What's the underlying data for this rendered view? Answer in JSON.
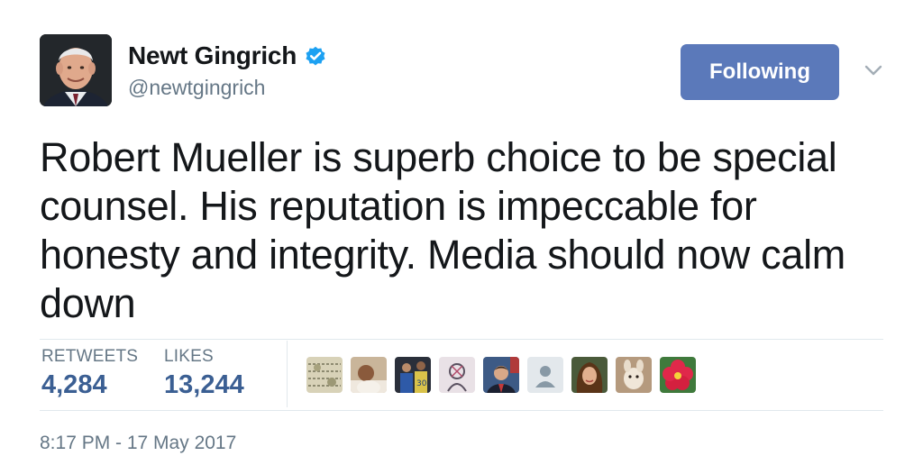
{
  "tweet": {
    "author": {
      "display_name": "Newt Gingrich",
      "handle": "@newtgingrich",
      "verified": true,
      "avatar_icon": "profile-photo"
    },
    "follow_button_label": "Following",
    "menu_icon": "chevron-down-icon",
    "text": "Robert Mueller is superb choice to be special counsel. His reputation is impeccable for honesty and integrity. Media should now calm down",
    "stats": {
      "retweets_label": "RETWEETS",
      "retweets_value": "4,284",
      "likes_label": "LIKES",
      "likes_value": "13,244"
    },
    "likers": [
      {
        "icon": "liker-avatar-pattern"
      },
      {
        "icon": "liker-avatar-photo"
      },
      {
        "icon": "liker-avatar-sports"
      },
      {
        "icon": "liker-avatar-drawing"
      },
      {
        "icon": "liker-avatar-suit"
      },
      {
        "icon": "liker-avatar-default"
      },
      {
        "icon": "liker-avatar-woman"
      },
      {
        "icon": "liker-avatar-animal"
      },
      {
        "icon": "liker-avatar-flower"
      }
    ],
    "timestamp": "8:17 PM - 17 May 2017"
  },
  "colors": {
    "follow_button_bg": "#5b79ba",
    "stat_value": "#3b5f93",
    "verified_badge": "#1da1f2",
    "secondary_text": "#657786"
  }
}
